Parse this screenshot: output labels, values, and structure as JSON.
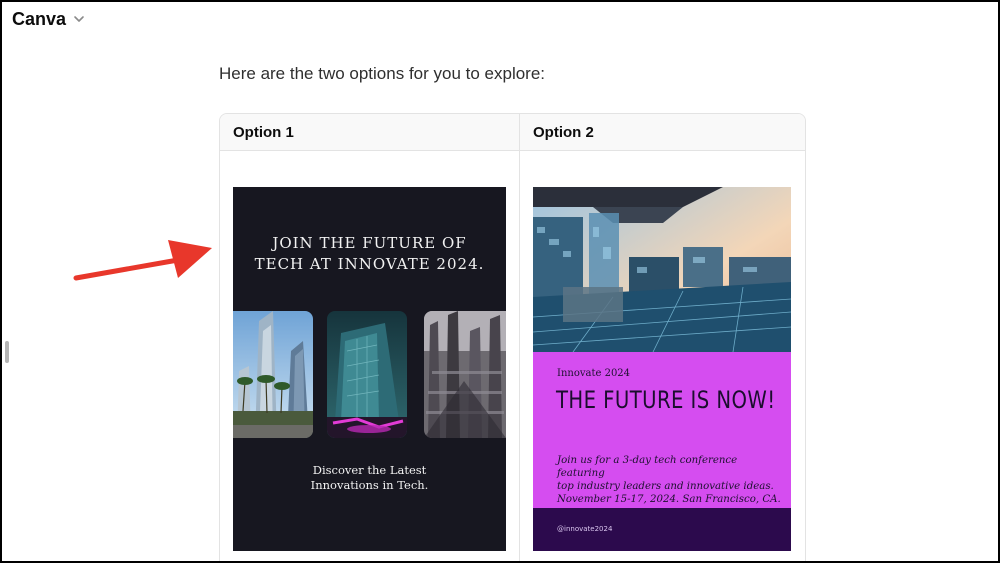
{
  "app": {
    "title": "Canva",
    "menu_icon": "chevron-down-icon"
  },
  "message": {
    "intro": "Here are the two options for you to explore:"
  },
  "table": {
    "headers": [
      "Option 1",
      "Option 2"
    ]
  },
  "option1": {
    "heading_line1": "JOIN THE FUTURE OF",
    "heading_line2": "TECH AT INNOVATE 2024.",
    "sub_line1": "Discover the Latest",
    "sub_line2": "Innovations in Tech.",
    "background": "#171720"
  },
  "option2": {
    "event": "Innovate 2024",
    "title": "THE FUTURE IS NOW!",
    "body_line1": "Join us for a 3-day tech conference featuring",
    "body_line2": "top industry leaders and innovative ideas.",
    "body_line3": "November 15-17, 2024. San Francisco, CA.",
    "handle": "@innovate2024",
    "panel_color": "#d54df0",
    "footer_color": "#2c0a4d"
  },
  "annotation": {
    "arrow_color": "#e8372b"
  }
}
